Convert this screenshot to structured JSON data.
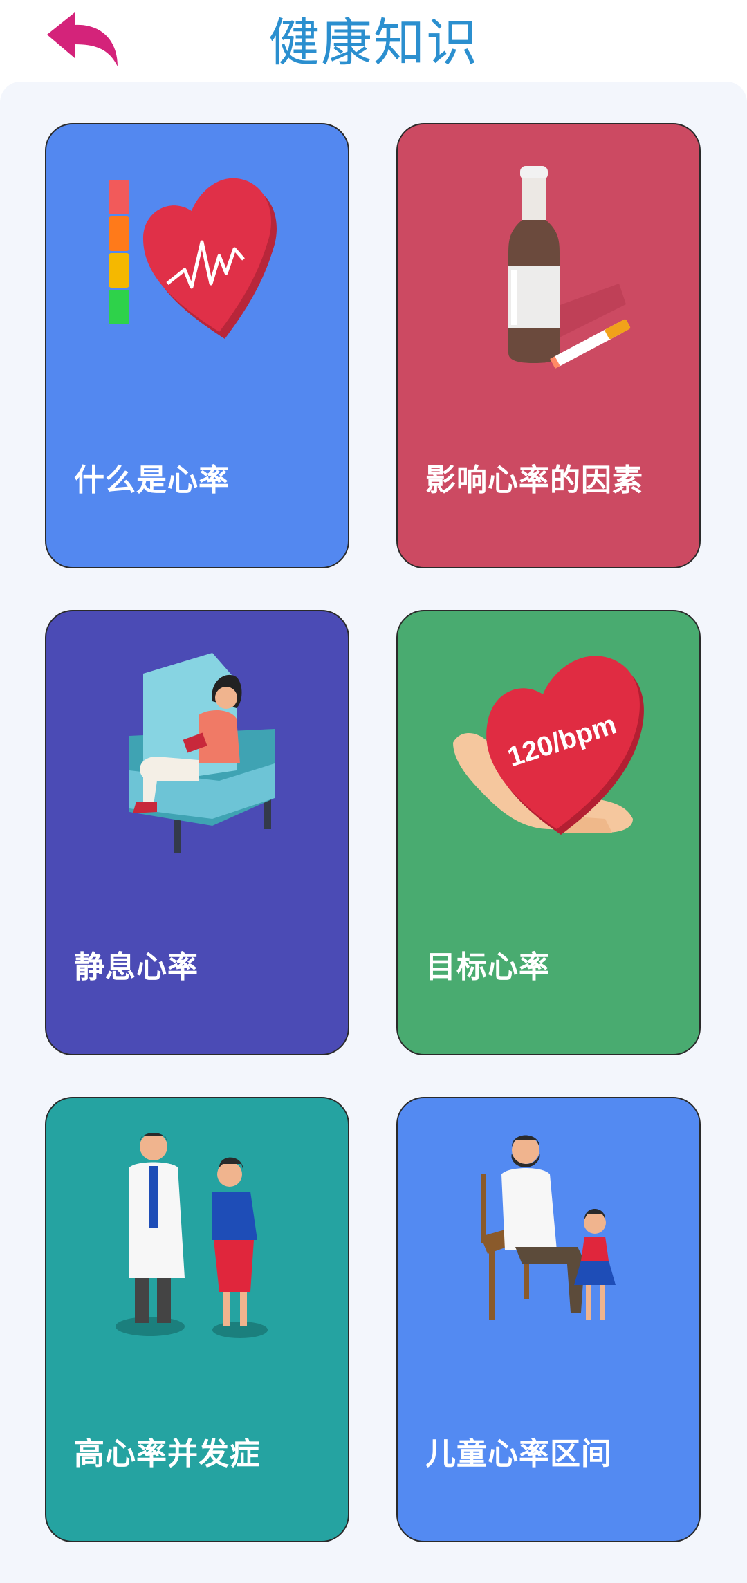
{
  "header": {
    "title": "健康知识",
    "title_color": "#2b8fcf",
    "back_icon": "back-arrow-icon",
    "back_color": "#d4237a"
  },
  "cards": [
    {
      "label": "什么是心率",
      "color": "#5388f0",
      "illustration": "heart-rate-meter-icon"
    },
    {
      "label": "影响心率的因素",
      "color": "#cc4a62",
      "illustration": "bottle-cigarette-icon"
    },
    {
      "label": "静息心率",
      "color": "#4b4bb5",
      "illustration": "woman-reading-chair-icon"
    },
    {
      "label": "目标心率",
      "color": "#49ab70",
      "illustration": "heart-in-hand-icon",
      "heart_text": "120/bpm"
    },
    {
      "label": "高心率并发症",
      "color": "#25a3a1",
      "illustration": "doctor-patient-icon"
    },
    {
      "label": "儿童心率区间",
      "color": "#538af2",
      "illustration": "doctor-child-icon"
    }
  ]
}
